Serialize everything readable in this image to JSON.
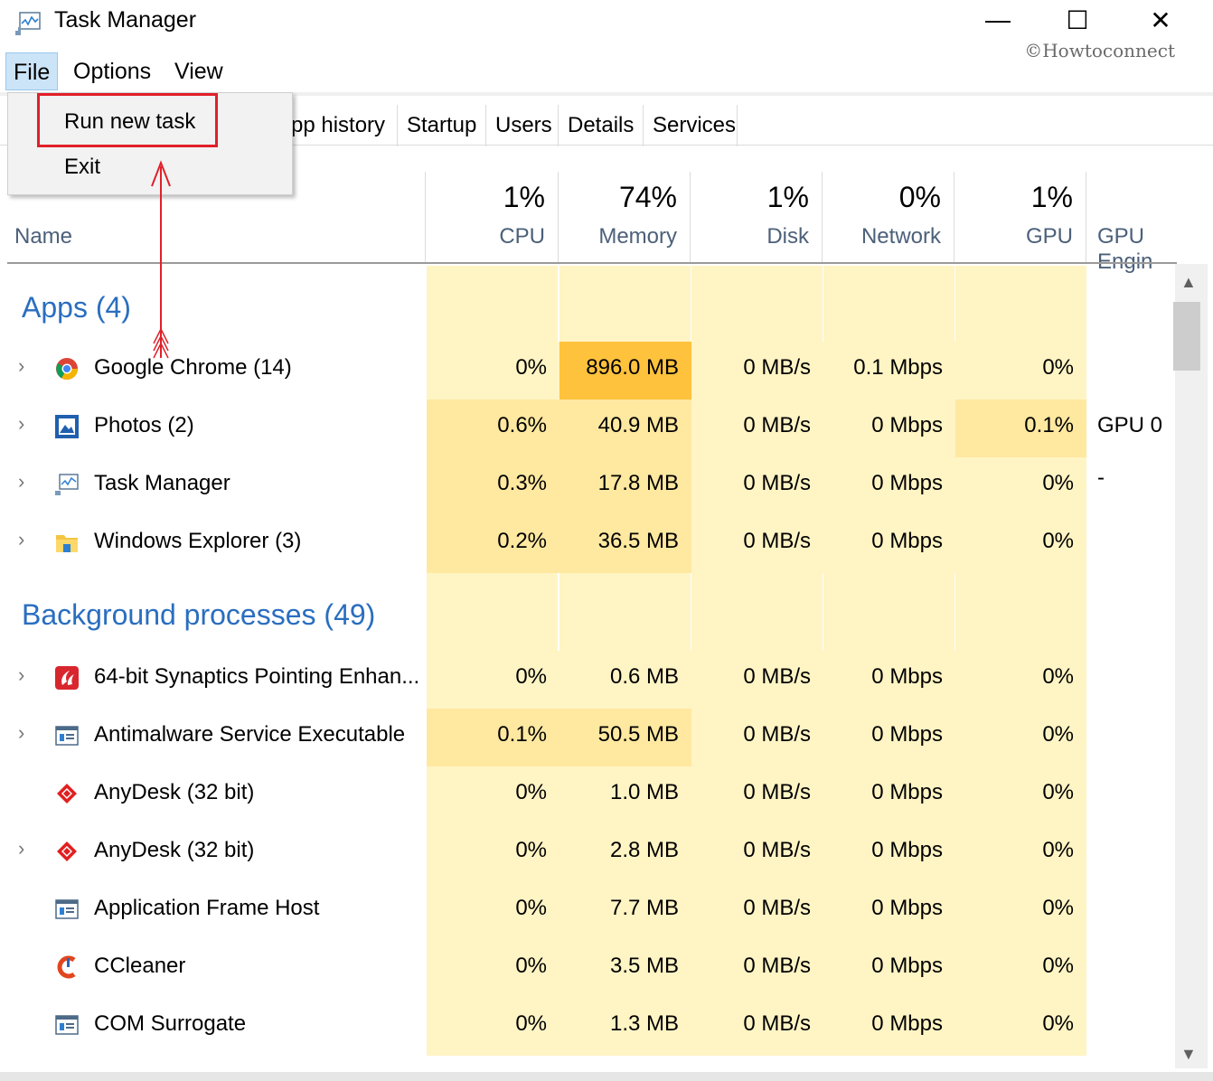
{
  "window": {
    "title": "Task Manager",
    "minimize": "—",
    "maximize": "☐",
    "close": "✕",
    "watermark": "©Howtoconnect"
  },
  "menubar": {
    "file": "File",
    "options": "Options",
    "view": "View"
  },
  "file_menu": {
    "run_new_task": "Run new task",
    "exit": "Exit"
  },
  "tabs": [
    "pp history",
    "Startup",
    "Users",
    "Details",
    "Services"
  ],
  "header": {
    "name": "Name",
    "cpu": {
      "pct": "1%",
      "label": "CPU"
    },
    "memory": {
      "pct": "74%",
      "label": "Memory"
    },
    "disk": {
      "pct": "1%",
      "label": "Disk"
    },
    "network": {
      "pct": "0%",
      "label": "Network"
    },
    "gpu": {
      "pct": "1%",
      "label": "GPU"
    },
    "gpu_engine": "GPU Engin"
  },
  "groups": {
    "apps": "Apps (4)",
    "background": "Background processes (49)"
  },
  "rows": [
    {
      "name": "Google Chrome (14)",
      "cpu": "0%",
      "memory": "896.0 MB",
      "disk": "0 MB/s",
      "network": "0.1 Mbps",
      "gpu": "0%",
      "gpu_engine": "",
      "icon": "chrome-icon",
      "expand": "›"
    },
    {
      "name": "Photos (2)",
      "cpu": "0.6%",
      "memory": "40.9 MB",
      "disk": "0 MB/s",
      "network": "0 Mbps",
      "gpu": "0.1%",
      "gpu_engine": "GPU 0 -",
      "icon": "photos-icon",
      "expand": "›"
    },
    {
      "name": "Task Manager",
      "cpu": "0.3%",
      "memory": "17.8 MB",
      "disk": "0 MB/s",
      "network": "0 Mbps",
      "gpu": "0%",
      "gpu_engine": "",
      "icon": "task-manager-icon",
      "expand": "›"
    },
    {
      "name": "Windows Explorer (3)",
      "cpu": "0.2%",
      "memory": "36.5 MB",
      "disk": "0 MB/s",
      "network": "0 Mbps",
      "gpu": "0%",
      "gpu_engine": "",
      "icon": "folder-icon",
      "expand": "›"
    },
    {
      "name": "64-bit Synaptics Pointing Enhan...",
      "cpu": "0%",
      "memory": "0.6 MB",
      "disk": "0 MB/s",
      "network": "0 Mbps",
      "gpu": "0%",
      "gpu_engine": "",
      "icon": "synaptics-icon",
      "expand": "›"
    },
    {
      "name": "Antimalware Service Executable",
      "cpu": "0.1%",
      "memory": "50.5 MB",
      "disk": "0 MB/s",
      "network": "0 Mbps",
      "gpu": "0%",
      "gpu_engine": "",
      "icon": "service-icon",
      "expand": "›"
    },
    {
      "name": "AnyDesk (32 bit)",
      "cpu": "0%",
      "memory": "1.0 MB",
      "disk": "0 MB/s",
      "network": "0 Mbps",
      "gpu": "0%",
      "gpu_engine": "",
      "icon": "anydesk-icon",
      "expand": ""
    },
    {
      "name": "AnyDesk (32 bit)",
      "cpu": "0%",
      "memory": "2.8 MB",
      "disk": "0 MB/s",
      "network": "0 Mbps",
      "gpu": "0%",
      "gpu_engine": "",
      "icon": "anydesk-icon",
      "expand": "›"
    },
    {
      "name": "Application Frame Host",
      "cpu": "0%",
      "memory": "7.7 MB",
      "disk": "0 MB/s",
      "network": "0 Mbps",
      "gpu": "0%",
      "gpu_engine": "",
      "icon": "service-icon",
      "expand": ""
    },
    {
      "name": "CCleaner",
      "cpu": "0%",
      "memory": "3.5 MB",
      "disk": "0 MB/s",
      "network": "0 Mbps",
      "gpu": "0%",
      "gpu_engine": "",
      "icon": "ccleaner-icon",
      "expand": ""
    },
    {
      "name": "COM Surrogate",
      "cpu": "0%",
      "memory": "1.3 MB",
      "disk": "0 MB/s",
      "network": "0 Mbps",
      "gpu": "0%",
      "gpu_engine": "",
      "icon": "service-icon",
      "expand": ""
    }
  ],
  "colors": {
    "heat_light": "#fff4c4",
    "heat_mid": "#ffe8a0",
    "heat_high": "#ffc23d",
    "group_blue": "#2a6ebf",
    "highlight_red": "#e0202a"
  }
}
